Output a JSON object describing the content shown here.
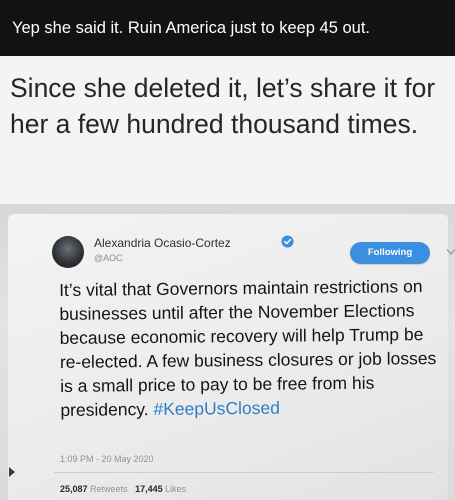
{
  "post": {
    "header_text": "Yep she said it. Ruin America just to keep 45 out.",
    "caption": "Since she deleted it, let’s share it for her a few hundred thousand times."
  },
  "tweet": {
    "author_name": "Alexandria Ocasio-Cortez",
    "handle": "@AOC",
    "follow_label": "Following",
    "body_text": "It’s vital that Governors maintain restrictions on businesses until after the November Elections because economic recovery will help Trump be re-elected. A few business closures or job losses is a small price to pay to be free from his presidency. ",
    "hashtag": "#KeepUsClosed",
    "timestamp": "1:09 PM - 20 May 2020",
    "retweets_count": "25,087",
    "retweets_label": "Retweets",
    "likes_count": "17,445",
    "likes_label": "Likes"
  },
  "icons": {
    "verified": "verified-badge-icon",
    "chevron": "chevron-down-icon"
  },
  "colors": {
    "header_bg": "#121212",
    "follow_button": "#3a8fe0",
    "hashtag": "#2f7ec4"
  }
}
